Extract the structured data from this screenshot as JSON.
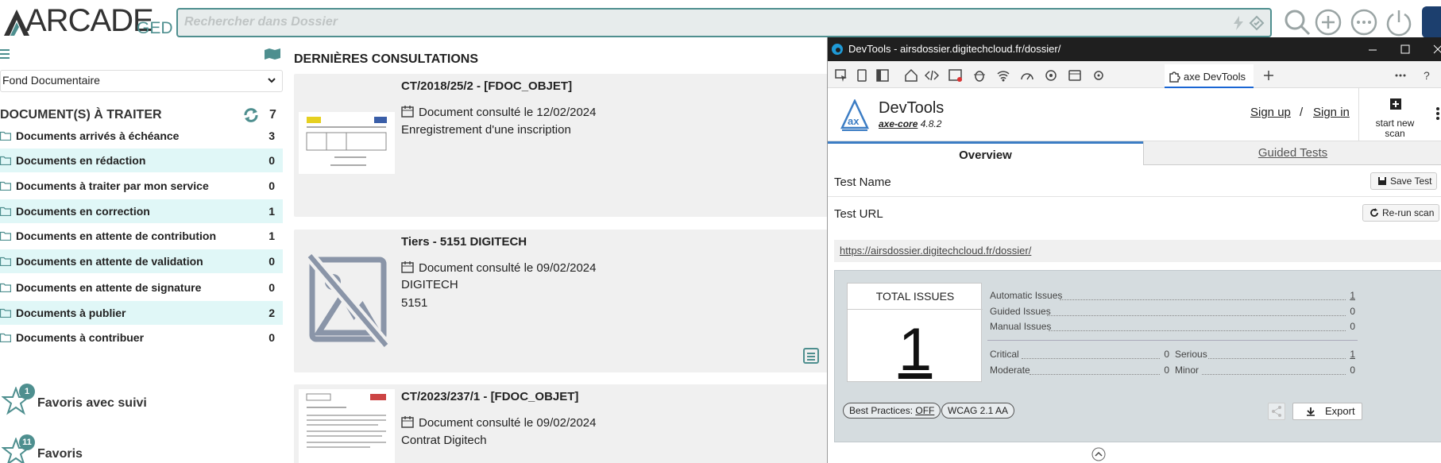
{
  "app": {
    "logo_text": "ARCADE",
    "logo_sub": "GED",
    "search_placeholder": "Rechercher dans Dossier"
  },
  "left": {
    "fond_select": "Fond Documentaire",
    "todo_title": "DOCUMENT(S) À TRAITER",
    "todo_total": "7",
    "rows": [
      {
        "label": "Documents arrivés à échéance",
        "count": "3"
      },
      {
        "label": "Documents en rédaction",
        "count": "0"
      },
      {
        "label": "Documents à traiter par mon service",
        "count": "0"
      },
      {
        "label": "Documents en correction",
        "count": "1"
      },
      {
        "label": "Documents en attente de contribution",
        "count": "1"
      },
      {
        "label": "Documents en attente de validation",
        "count": "0"
      },
      {
        "label": "Documents en attente de signature",
        "count": "0"
      },
      {
        "label": "Documents à publier",
        "count": "2"
      },
      {
        "label": "Documents à contribuer",
        "count": "0"
      }
    ],
    "favorites": [
      {
        "label": "Favoris avec suivi",
        "badge": "1"
      },
      {
        "label": "Favoris",
        "badge": "11"
      }
    ]
  },
  "main": {
    "title": "DERNIÈRES CONSULTATIONS",
    "cards": [
      {
        "title": "CT/2018/25/2 - [FDOC_OBJET]",
        "consulted": "Document consulté le 12/02/2024",
        "lines": [
          "Enregistrement d'une inscription"
        ]
      },
      {
        "title": "Tiers - 5151 DIGITECH",
        "consulted": "Document consulté le 09/02/2024",
        "lines": [
          "DIGITECH",
          "5151"
        ]
      },
      {
        "title": "CT/2023/237/1 - [FDOC_OBJET]",
        "consulted": "Document consulté le 09/02/2024",
        "lines": [
          "Contrat Digitech"
        ]
      }
    ]
  },
  "devtools": {
    "window_title": "DevTools - airsdossier.digitechcloud.fr/dossier/",
    "active_tab": "axe DevTools",
    "brand": "DevTools",
    "version_name": "axe-core",
    "version_number": "4.8.2",
    "sign_up": "Sign up",
    "separator": "/",
    "sign_in": "Sign in",
    "start_scan_line1": "start new",
    "start_scan_line2": "scan",
    "tab_overview": "Overview",
    "tab_guided": "Guided Tests",
    "test_name_label": "Test Name",
    "save_test": "Save Test",
    "test_url_label": "Test URL",
    "rerun": "Re-run scan",
    "url": "https://airsdossier.digitechcloud.fr/dossier/",
    "total_label": "TOTAL ISSUES",
    "total": "1",
    "automatic_label": "Automatic Issues",
    "automatic": "1",
    "guided_label": "Guided Issues",
    "guided": "0",
    "manual_label": "Manual Issues",
    "manual": "0",
    "critical_label": "Critical",
    "critical": "0",
    "serious_label": "Serious",
    "serious": "1",
    "moderate_label": "Moderate",
    "moderate": "0",
    "minor_label": "Minor",
    "minor": "0",
    "best_practices": "Best Practices:",
    "best_practices_state": "OFF",
    "wcag": "WCAG 2.1 AA",
    "export": "Export"
  },
  "colors": {
    "accent": "#4e8f8f",
    "highlight_row": "#e0f7f7",
    "axe_blue": "#3c7dc4"
  }
}
